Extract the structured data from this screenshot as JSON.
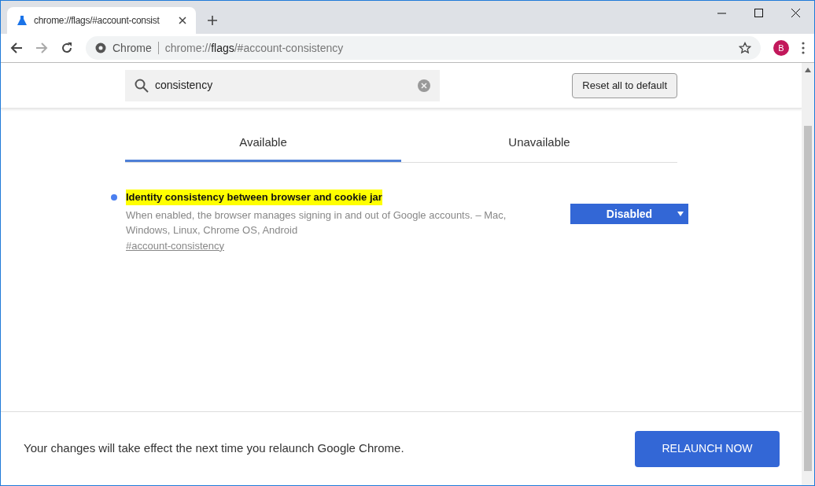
{
  "browser_tab": {
    "title": "chrome://flags/#account-consist",
    "selected": true
  },
  "address_bar": {
    "site_label": "Chrome",
    "url_prefix": "chrome://",
    "url_host": "flags",
    "url_suffix": "/#account-consistency"
  },
  "profile": {
    "initial": "B"
  },
  "search": {
    "value": "consistency"
  },
  "reset_button": "Reset all to default",
  "tabs": [
    {
      "label": "Available",
      "selected": true
    },
    {
      "label": "Unavailable",
      "selected": false
    }
  ],
  "flags": [
    {
      "title": "Identity consistency between browser and cookie jar",
      "description": "When enabled, the browser manages signing in and out of Google accounts. – Mac, Windows, Linux, Chrome OS, Android",
      "anchor": "#account-consistency",
      "value": "Disabled"
    }
  ],
  "footer": {
    "message": "Your changes will take effect the next time you relaunch Google Chrome.",
    "button": "RELAUNCH NOW"
  }
}
